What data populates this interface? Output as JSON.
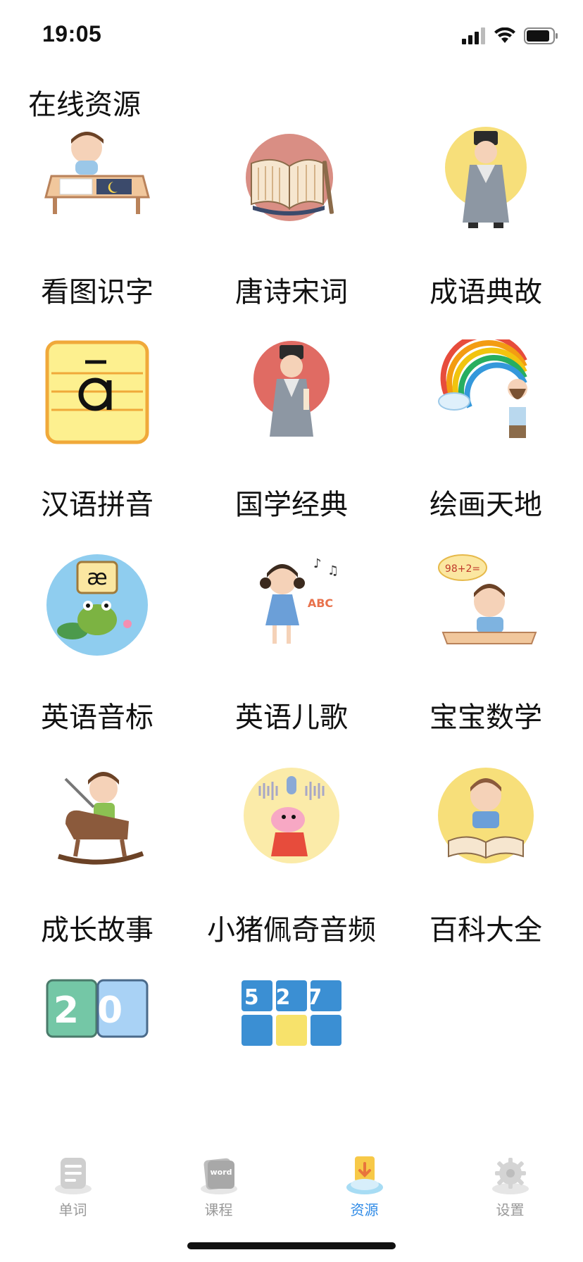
{
  "status_bar": {
    "time": "19:05"
  },
  "page": {
    "title": "在线资源"
  },
  "resources": [
    {
      "label": "看图识字",
      "icon": "kid-reading-icon"
    },
    {
      "label": "唐诗宋词",
      "icon": "scroll-book-icon"
    },
    {
      "label": "成语典故",
      "icon": "scholar-icon"
    },
    {
      "label": "汉语拼音",
      "icon": "pinyin-a-icon"
    },
    {
      "label": "国学经典",
      "icon": "confucian-scholar-icon"
    },
    {
      "label": "绘画天地",
      "icon": "rainbow-painter-icon"
    },
    {
      "label": "英语音标",
      "icon": "phonetic-frog-icon",
      "glyph": "æ"
    },
    {
      "label": "英语儿歌",
      "icon": "singing-girl-icon",
      "glyph": "ABC"
    },
    {
      "label": "宝宝数学",
      "icon": "math-kid-icon",
      "glyph": "98+2="
    },
    {
      "label": "成长故事",
      "icon": "rocking-horse-icon"
    },
    {
      "label": "小猪佩奇音频",
      "icon": "peppa-pig-icon"
    },
    {
      "label": "百科大全",
      "icon": "kid-book-icon"
    },
    {
      "label": "",
      "icon": "number-cards-icon",
      "glyph": "20"
    },
    {
      "label": "",
      "icon": "number-puzzle-icon",
      "glyph": "527"
    }
  ],
  "tabs": [
    {
      "label": "单词",
      "icon": "word-list-icon",
      "active": false
    },
    {
      "label": "课程",
      "icon": "word-card-icon",
      "active": false,
      "glyph": "word"
    },
    {
      "label": "资源",
      "icon": "cloud-download-icon",
      "active": true
    },
    {
      "label": "设置",
      "icon": "gear-icon",
      "active": false
    }
  ],
  "colors": {
    "accent": "#2e8ae6",
    "inactive": "#999999"
  }
}
